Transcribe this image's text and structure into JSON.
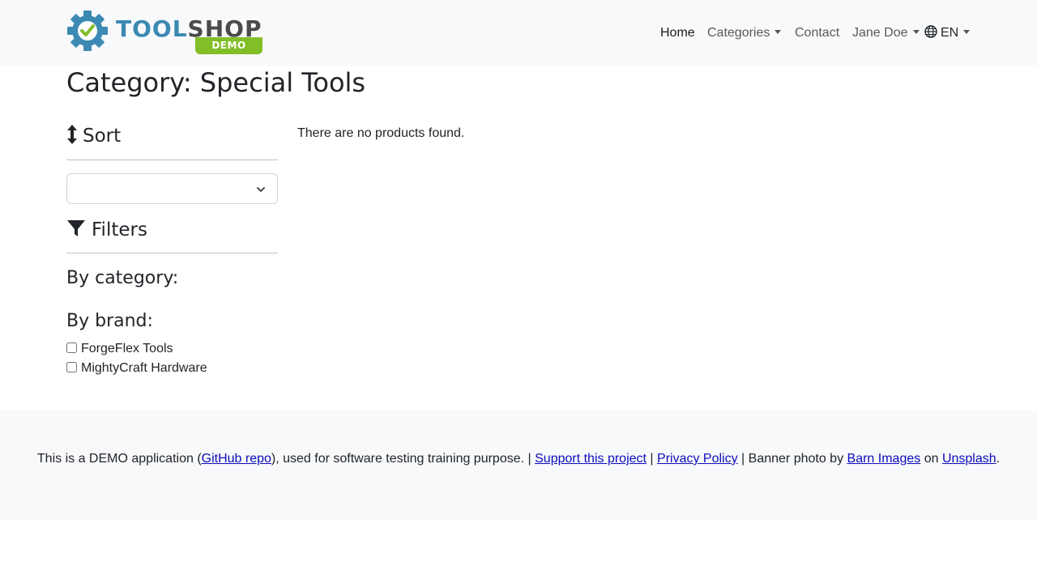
{
  "brand": {
    "logo_text_1": "TOOL",
    "logo_text_2": "SHOP",
    "logo_badge": "DEMO",
    "colors": {
      "tool_blue": "#3c8ab3",
      "shop_gray": "#4b4b4b",
      "badge_green": "#82be28",
      "check_green": "#82be28"
    }
  },
  "nav": {
    "home": "Home",
    "categories": "Categories",
    "contact": "Contact",
    "user": "Jane Doe",
    "language": "EN"
  },
  "page": {
    "title": "Category: Special Tools"
  },
  "sidebar": {
    "sort_heading": "Sort",
    "sort_value": "",
    "filters_heading": "Filters",
    "by_category": "By category:",
    "by_brand": "By brand:",
    "brands": [
      {
        "label": "ForgeFlex Tools",
        "checked": false
      },
      {
        "label": "MightyCraft Hardware",
        "checked": false
      }
    ]
  },
  "main": {
    "empty_message": "There are no products found."
  },
  "footer": {
    "part1": "This is a DEMO application (",
    "github_link": "GitHub repo",
    "part2": "), used for software testing training purpose. | ",
    "support_link": "Support this project",
    "sep1": " | ",
    "privacy_link": "Privacy Policy",
    "part3": " | Banner photo by ",
    "barn_link": "Barn Images",
    "part4": " on ",
    "unsplash_link": "Unsplash",
    "part5": "."
  }
}
